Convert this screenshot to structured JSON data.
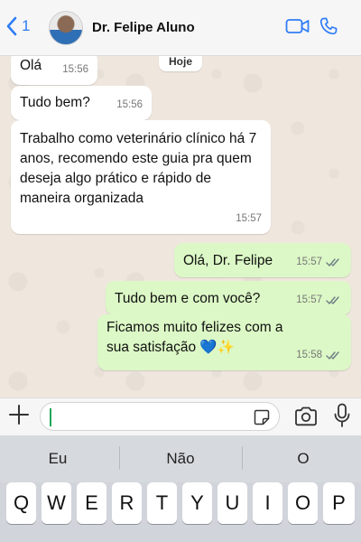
{
  "header": {
    "back_count": "1",
    "contact_name": "Dr. Felipe Aluno",
    "back_icon": "chevron-left-icon",
    "video_icon": "video-call-icon",
    "phone_icon": "phone-icon"
  },
  "chat": {
    "date_chip": "Hoje",
    "messages": [
      {
        "dir": "in",
        "text": "Olá",
        "time": "15:56"
      },
      {
        "dir": "in",
        "text": "Tudo bem?",
        "time": "15:56"
      },
      {
        "dir": "in",
        "text": "Trabalho como veterinário clínico há 7 anos, recomendo este guia pra quem deseja algo prático e rápido de maneira organizada",
        "time": "15:57"
      },
      {
        "dir": "out",
        "text": "Olá, Dr. Felipe",
        "time": "15:57"
      },
      {
        "dir": "out",
        "text": "Tudo bem e com você?",
        "time": "15:57"
      },
      {
        "dir": "out",
        "text": "Ficamos muito felizes com a sua satisfação 💙✨",
        "time": "15:58"
      }
    ]
  },
  "input": {
    "value": "",
    "plus_icon": "plus-icon",
    "sticker_icon": "sticker-icon",
    "camera_icon": "camera-icon",
    "mic_icon": "microphone-icon"
  },
  "keyboard": {
    "suggestions": [
      "Eu",
      "Não",
      "O"
    ],
    "row1": [
      "Q",
      "W",
      "E",
      "R",
      "T",
      "Y",
      "U",
      "I",
      "O",
      "P"
    ]
  },
  "colors": {
    "accent_blue": "#2f7df6",
    "outgoing_bubble": "#dcf8c6",
    "incoming_bubble": "#ffffff",
    "chat_bg": "#efe7de",
    "caret_green": "#22a75a"
  }
}
